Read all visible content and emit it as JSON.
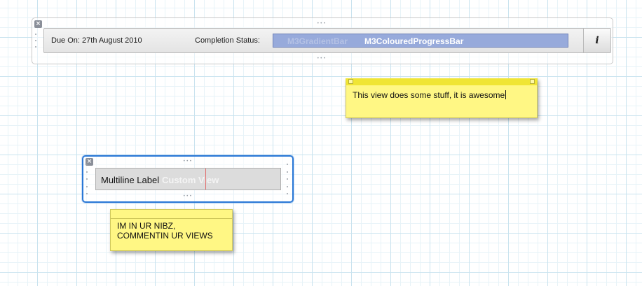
{
  "top_bar": {
    "due_label": "Due On: 27th August 2010",
    "status_label": "Completion Status:",
    "gradient_bar_ghost_label": "M3GradientBar",
    "progress_bar_label": "M3ColouredProgressBar",
    "progress_fraction": 1.0,
    "progress_color": "#97aadb",
    "info_button_label": "i",
    "info_icon": "info-icon"
  },
  "note_awesome": {
    "text": "This view does some stuff, it is awesome"
  },
  "custom_view": {
    "label": "Multiline Label",
    "ghost_label": "Custom View"
  },
  "note_nibz": {
    "line1": "IM IN UR NIBZ,",
    "line2": "COMMENTIN UR VIEWS"
  },
  "colors": {
    "note_yellow": "#fff784",
    "selection_blue": "#2a78d6",
    "grid": "#c9e3ef"
  }
}
